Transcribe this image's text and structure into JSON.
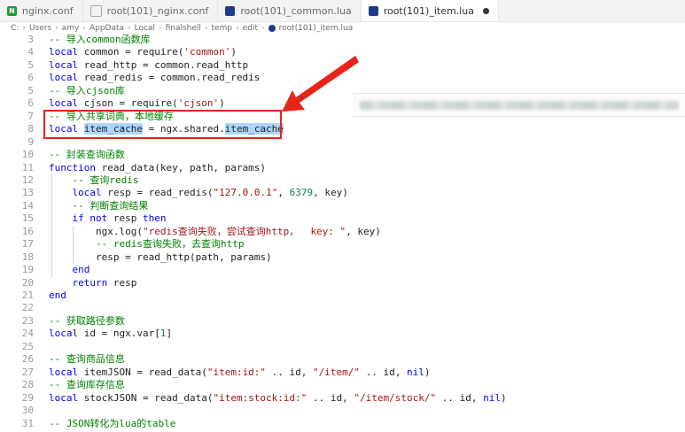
{
  "tabs": [
    {
      "label": "nginx.conf",
      "icon": "nginx-icon",
      "active": false
    },
    {
      "label": "root(101)_nginx.conf",
      "icon": "file-icon",
      "active": false
    },
    {
      "label": "root(101)_common.lua",
      "icon": "lua-icon",
      "active": false
    },
    {
      "label": "root(101)_item.lua",
      "icon": "lua-icon",
      "active": true,
      "modified": true
    }
  ],
  "breadcrumb": [
    "C:",
    "Users",
    "amy",
    "AppData",
    "Local",
    "finalshell",
    "temp",
    "edit",
    "root(101)_item.lua"
  ],
  "code_lines": [
    {
      "n": "3",
      "text": "    -- 导入common函数库"
    },
    {
      "n": "4",
      "text": "    local common = require('common')"
    },
    {
      "n": "5",
      "text": "    local read_http = common.read_http"
    },
    {
      "n": "6",
      "text": "    local read_redis = common.read_redis"
    },
    {
      "n": "5",
      "text": "    -- 导入cjson库"
    },
    {
      "n": "6",
      "text": "    local cjson = require('cjson')"
    },
    {
      "n": "7",
      "text": "    -- 导入共享词典，本地缓存"
    },
    {
      "n": "8",
      "text": "    local item_cache = ngx.shared.item_cache"
    },
    {
      "n": "9",
      "text": ""
    },
    {
      "n": "10",
      "text": "    -- 封装查询函数"
    },
    {
      "n": "11",
      "text": "    function read_data(key, path, params)"
    },
    {
      "n": "12",
      "text": "        -- 查询redis"
    },
    {
      "n": "13",
      "text": "        local resp = read_redis(\"127.0.0.1\", 6379, key)"
    },
    {
      "n": "14",
      "text": "        -- 判断查询结果"
    },
    {
      "n": "15",
      "text": "        if not resp then"
    },
    {
      "n": "16",
      "text": "            ngx.log(\"redis查询失败，尝试查询http，  key: \", key)"
    },
    {
      "n": "17",
      "text": "            -- redis查询失败，去查询http"
    },
    {
      "n": "18",
      "text": "            resp = read_http(path, params)"
    },
    {
      "n": "19",
      "text": "        end"
    },
    {
      "n": "20",
      "text": "        return resp"
    },
    {
      "n": "21",
      "text": "    end"
    },
    {
      "n": "22",
      "text": ""
    },
    {
      "n": "23",
      "text": "    -- 获取路径参数"
    },
    {
      "n": "24",
      "text": "    local id = ngx.var[1]"
    },
    {
      "n": "25",
      "text": ""
    },
    {
      "n": "26",
      "text": "    -- 查询商品信息"
    },
    {
      "n": "27",
      "text": "    local itemJSON = read_data(\"item:id:\" .. id, \"/item/\" .. id, nil)"
    },
    {
      "n": "28",
      "text": "    -- 查询库存信息"
    },
    {
      "n": "29",
      "text": "    local stockJSON = read_data(\"item:stock:id:\" .. id, \"/item/stock/\" .. id, nil)"
    },
    {
      "n": "30",
      "text": ""
    },
    {
      "n": "31",
      "text": "    -- JSON转化为lua的table"
    }
  ],
  "line_numbers": [
    "3",
    "4",
    "5",
    "6",
    "5",
    "6",
    "7",
    "8",
    "9",
    "10",
    "11",
    "12",
    "13",
    "14",
    "15",
    "16",
    "17",
    "18",
    "19",
    "20",
    "21",
    "22",
    "23",
    "24",
    "25",
    "26",
    "27",
    "28",
    "29",
    "30",
    "31"
  ],
  "colors": {
    "highlight_box": "#e8231a",
    "comment": "#008000",
    "keyword": "#0000ff",
    "string": "#a31515",
    "number": "#098658",
    "selection": "#add6ff"
  }
}
